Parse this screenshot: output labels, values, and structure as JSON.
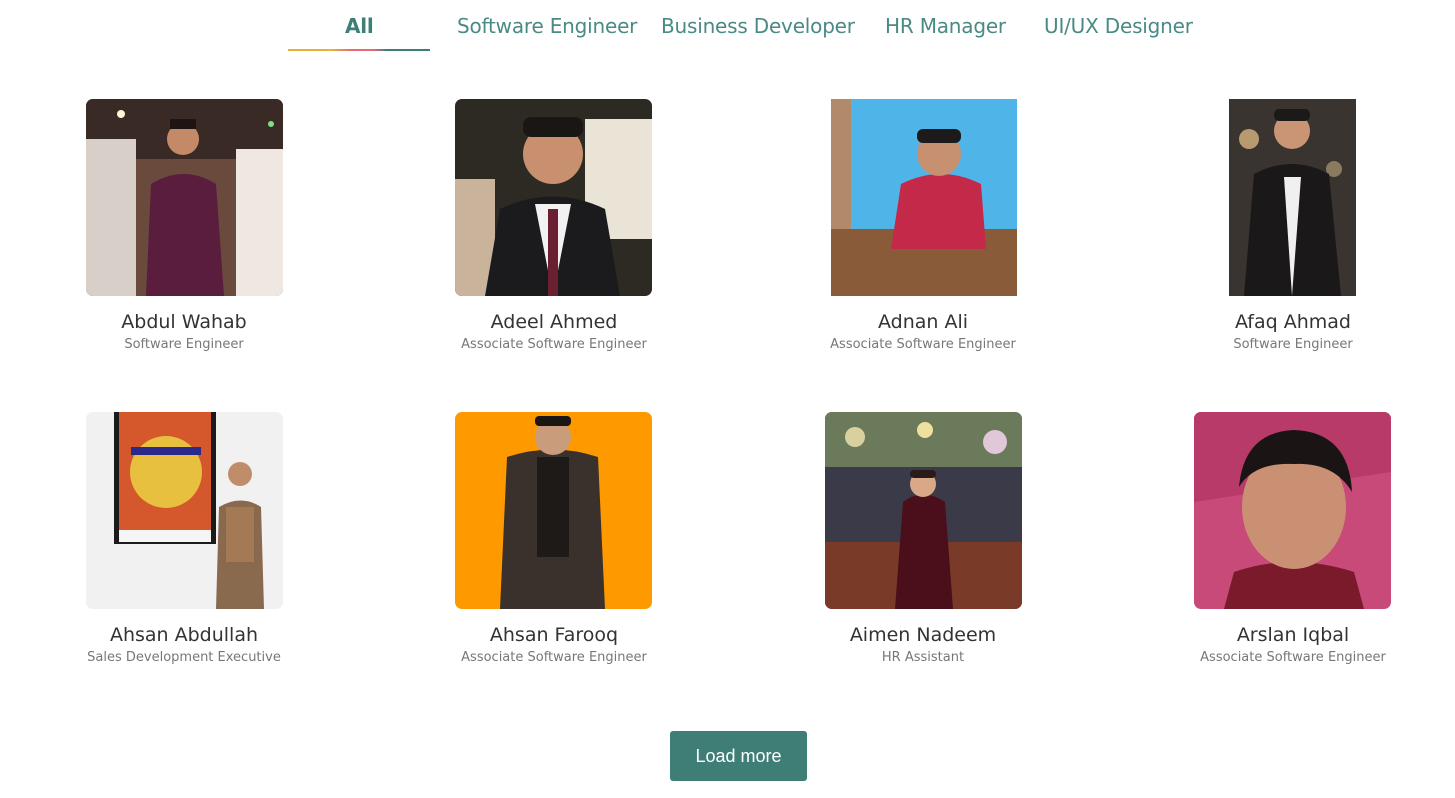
{
  "tabs": [
    {
      "label": "All",
      "active": true
    },
    {
      "label": "Software Engineer",
      "active": false
    },
    {
      "label": "Business Developer",
      "active": false
    },
    {
      "label": "HR Manager",
      "active": false
    },
    {
      "label": "UI/UX Designer",
      "active": false
    }
  ],
  "accent_color": "#3e7e77",
  "team": [
    {
      "name": "Abdul Wahab",
      "role": "Software Engineer"
    },
    {
      "name": "Adeel Ahmed",
      "role": "Associate Software Engineer"
    },
    {
      "name": "Adnan Ali",
      "role": "Associate Software Engineer"
    },
    {
      "name": "Afaq Ahmad",
      "role": "Software Engineer"
    },
    {
      "name": "Ahsan Abdullah",
      "role": "Sales Development Executive"
    },
    {
      "name": "Ahsan Farooq",
      "role": "Associate Software Engineer"
    },
    {
      "name": "Aimen Nadeem",
      "role": "HR Assistant"
    },
    {
      "name": "Arslan Iqbal",
      "role": "Associate Software Engineer"
    }
  ],
  "load_more": {
    "label": "Load more"
  }
}
